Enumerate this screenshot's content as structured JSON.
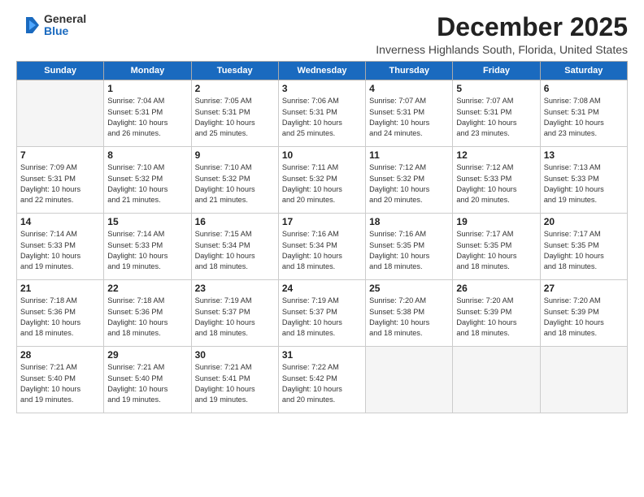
{
  "logo": {
    "general": "General",
    "blue": "Blue"
  },
  "header": {
    "month": "December 2025",
    "location": "Inverness Highlands South, Florida, United States"
  },
  "days_of_week": [
    "Sunday",
    "Monday",
    "Tuesday",
    "Wednesday",
    "Thursday",
    "Friday",
    "Saturday"
  ],
  "weeks": [
    [
      {
        "day": "",
        "info": ""
      },
      {
        "day": "1",
        "info": "Sunrise: 7:04 AM\nSunset: 5:31 PM\nDaylight: 10 hours\nand 26 minutes."
      },
      {
        "day": "2",
        "info": "Sunrise: 7:05 AM\nSunset: 5:31 PM\nDaylight: 10 hours\nand 25 minutes."
      },
      {
        "day": "3",
        "info": "Sunrise: 7:06 AM\nSunset: 5:31 PM\nDaylight: 10 hours\nand 25 minutes."
      },
      {
        "day": "4",
        "info": "Sunrise: 7:07 AM\nSunset: 5:31 PM\nDaylight: 10 hours\nand 24 minutes."
      },
      {
        "day": "5",
        "info": "Sunrise: 7:07 AM\nSunset: 5:31 PM\nDaylight: 10 hours\nand 23 minutes."
      },
      {
        "day": "6",
        "info": "Sunrise: 7:08 AM\nSunset: 5:31 PM\nDaylight: 10 hours\nand 23 minutes."
      }
    ],
    [
      {
        "day": "7",
        "info": "Sunrise: 7:09 AM\nSunset: 5:31 PM\nDaylight: 10 hours\nand 22 minutes."
      },
      {
        "day": "8",
        "info": "Sunrise: 7:10 AM\nSunset: 5:32 PM\nDaylight: 10 hours\nand 21 minutes."
      },
      {
        "day": "9",
        "info": "Sunrise: 7:10 AM\nSunset: 5:32 PM\nDaylight: 10 hours\nand 21 minutes."
      },
      {
        "day": "10",
        "info": "Sunrise: 7:11 AM\nSunset: 5:32 PM\nDaylight: 10 hours\nand 20 minutes."
      },
      {
        "day": "11",
        "info": "Sunrise: 7:12 AM\nSunset: 5:32 PM\nDaylight: 10 hours\nand 20 minutes."
      },
      {
        "day": "12",
        "info": "Sunrise: 7:12 AM\nSunset: 5:33 PM\nDaylight: 10 hours\nand 20 minutes."
      },
      {
        "day": "13",
        "info": "Sunrise: 7:13 AM\nSunset: 5:33 PM\nDaylight: 10 hours\nand 19 minutes."
      }
    ],
    [
      {
        "day": "14",
        "info": "Sunrise: 7:14 AM\nSunset: 5:33 PM\nDaylight: 10 hours\nand 19 minutes."
      },
      {
        "day": "15",
        "info": "Sunrise: 7:14 AM\nSunset: 5:33 PM\nDaylight: 10 hours\nand 19 minutes."
      },
      {
        "day": "16",
        "info": "Sunrise: 7:15 AM\nSunset: 5:34 PM\nDaylight: 10 hours\nand 18 minutes."
      },
      {
        "day": "17",
        "info": "Sunrise: 7:16 AM\nSunset: 5:34 PM\nDaylight: 10 hours\nand 18 minutes."
      },
      {
        "day": "18",
        "info": "Sunrise: 7:16 AM\nSunset: 5:35 PM\nDaylight: 10 hours\nand 18 minutes."
      },
      {
        "day": "19",
        "info": "Sunrise: 7:17 AM\nSunset: 5:35 PM\nDaylight: 10 hours\nand 18 minutes."
      },
      {
        "day": "20",
        "info": "Sunrise: 7:17 AM\nSunset: 5:35 PM\nDaylight: 10 hours\nand 18 minutes."
      }
    ],
    [
      {
        "day": "21",
        "info": "Sunrise: 7:18 AM\nSunset: 5:36 PM\nDaylight: 10 hours\nand 18 minutes."
      },
      {
        "day": "22",
        "info": "Sunrise: 7:18 AM\nSunset: 5:36 PM\nDaylight: 10 hours\nand 18 minutes."
      },
      {
        "day": "23",
        "info": "Sunrise: 7:19 AM\nSunset: 5:37 PM\nDaylight: 10 hours\nand 18 minutes."
      },
      {
        "day": "24",
        "info": "Sunrise: 7:19 AM\nSunset: 5:37 PM\nDaylight: 10 hours\nand 18 minutes."
      },
      {
        "day": "25",
        "info": "Sunrise: 7:20 AM\nSunset: 5:38 PM\nDaylight: 10 hours\nand 18 minutes."
      },
      {
        "day": "26",
        "info": "Sunrise: 7:20 AM\nSunset: 5:39 PM\nDaylight: 10 hours\nand 18 minutes."
      },
      {
        "day": "27",
        "info": "Sunrise: 7:20 AM\nSunset: 5:39 PM\nDaylight: 10 hours\nand 18 minutes."
      }
    ],
    [
      {
        "day": "28",
        "info": "Sunrise: 7:21 AM\nSunset: 5:40 PM\nDaylight: 10 hours\nand 19 minutes."
      },
      {
        "day": "29",
        "info": "Sunrise: 7:21 AM\nSunset: 5:40 PM\nDaylight: 10 hours\nand 19 minutes."
      },
      {
        "day": "30",
        "info": "Sunrise: 7:21 AM\nSunset: 5:41 PM\nDaylight: 10 hours\nand 19 minutes."
      },
      {
        "day": "31",
        "info": "Sunrise: 7:22 AM\nSunset: 5:42 PM\nDaylight: 10 hours\nand 20 minutes."
      },
      {
        "day": "",
        "info": ""
      },
      {
        "day": "",
        "info": ""
      },
      {
        "day": "",
        "info": ""
      }
    ]
  ]
}
